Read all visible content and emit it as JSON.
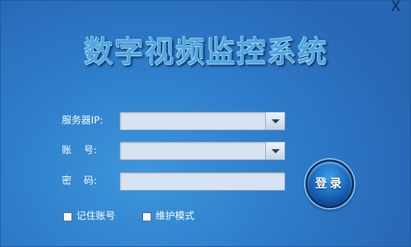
{
  "window": {
    "title": "数字视频监控系统",
    "close_glyph": "X"
  },
  "form": {
    "server_ip": {
      "label": "服务器IP:",
      "value": ""
    },
    "account": {
      "label": "账    号:",
      "value": ""
    },
    "password": {
      "label": "密    码:",
      "value": ""
    }
  },
  "login_button": {
    "label": "登录"
  },
  "options": {
    "remember_account": {
      "label": "记住账号",
      "checked": false
    },
    "maintenance_mode": {
      "label": "维护模式",
      "checked": false
    }
  },
  "icons": {
    "dropdown": "chevron-down-icon",
    "close": "close-icon"
  },
  "colors": {
    "background": "#2f7fcc",
    "field": "#d7e3f1",
    "login_button": "#1d6fc2",
    "title": "#4fa6e0"
  }
}
